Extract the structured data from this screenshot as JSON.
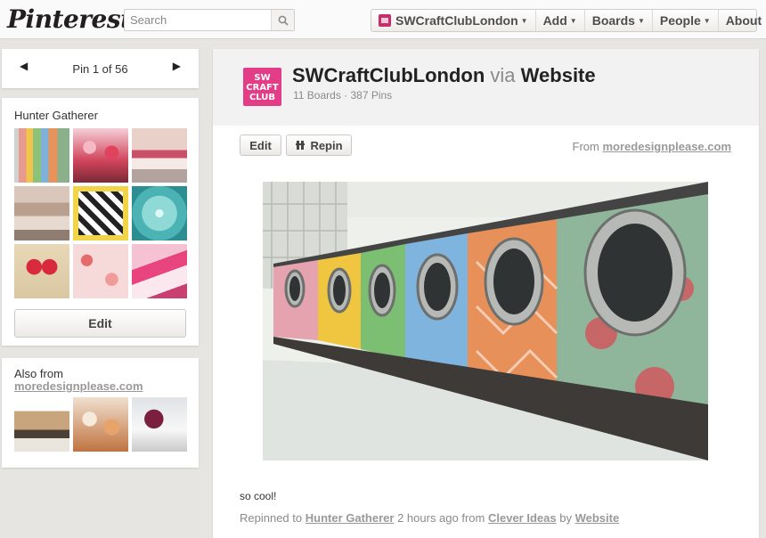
{
  "header": {
    "logo": "Pinterest",
    "search_placeholder": "Search",
    "user": "SWCraftClubLondon",
    "nav": [
      "Add",
      "Boards",
      "People",
      "About"
    ]
  },
  "pager": {
    "label": "Pin 1 of 56"
  },
  "board": {
    "title": "Hunter Gatherer",
    "edit_label": "Edit",
    "thumbs": [
      "washing-machines",
      "pink-bunting",
      "cake-table",
      "sewing-machine",
      "chevron-pillow",
      "blue-dahlia",
      "red-heart",
      "floral-fabric",
      "pink-craft-supplies"
    ]
  },
  "also": {
    "title": "Also from",
    "source": "moredesignplease.com",
    "thumbs": [
      "paper-houses",
      "ice-cream-cones",
      "berry-tart"
    ]
  },
  "pin": {
    "avatar_text": [
      "SW",
      "CRAFT",
      "CLUB"
    ],
    "owner": "SWCraftClubLondon",
    "via": "via",
    "source_name": "Website",
    "stats": "11 Boards · 387 Pins",
    "edit_label": "Edit",
    "repin_label": "Repin",
    "from_label": "From",
    "from_domain": "moredesignplease.com",
    "description": "so cool!",
    "repinned_to": "Repinned to",
    "board": "Hunter Gatherer",
    "time": "2 hours ago from",
    "from_board": "Clever Ideas",
    "by": "by",
    "by_source": "Website"
  },
  "colors": {
    "accent": "#e33d87",
    "link": "#999999",
    "background": "#e6e5e2"
  }
}
